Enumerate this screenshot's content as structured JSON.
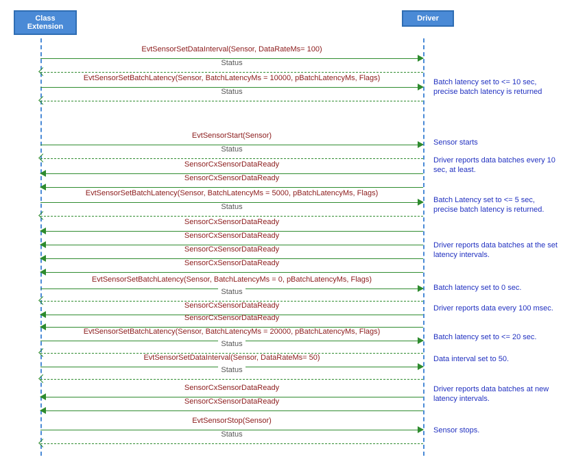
{
  "actors": {
    "left": "Class Extension",
    "right": "Driver"
  },
  "messages": {
    "m01": "EvtSensorSetDataInterval(Sensor, DataRateMs= 100)",
    "s01": "Status",
    "m02": "EvtSensorSetBatchLatency(Sensor, BatchLatencyMs = 10000, pBatchLatencyMs, Flags)",
    "s02": "Status",
    "m03": "EvtSensorStart(Sensor)",
    "s03": "Status",
    "m04": "SensorCxSensorDataReady",
    "m05": "SensorCxSensorDataReady",
    "m06": "EvtSensorSetBatchLatency(Sensor, BatchLatencyMs =  5000, pBatchLatencyMs, Flags)",
    "s06": "Status",
    "m07": "SensorCxSensorDataReady",
    "m08": "SensorCxSensorDataReady",
    "m09": "SensorCxSensorDataReady",
    "m10": "SensorCxSensorDataReady",
    "m11": "EvtSensorSetBatchLatency(Sensor, BatchLatencyMs = 0,  pBatchLatencyMs, Flags)",
    "s11": "Status",
    "m12": "SensorCxSensorDataReady",
    "m13": "SensorCxSensorDataReady",
    "m14": "EvtSensorSetBatchLatency(Sensor, BatchLatencyMs = 20000, pBatchLatencyMs, Flags)",
    "s14": "Status",
    "m15": "EvtSensorSetDataInterval(Sensor, DataRateMs= 50)",
    "s15": "Status",
    "m16": "SensorCxSensorDataReady",
    "m17": "SensorCxSensorDataReady",
    "m18": "EvtSensorStop(Sensor)",
    "s18": "Status"
  },
  "notes": {
    "a": "Batch latency set to <= 10 sec, precise batch latency is returned",
    "b": "Sensor starts",
    "c": "Driver reports data batches every 10 sec, at least.",
    "d": "Batch Latency set to <= 5 sec, precise batch latency is returned.",
    "e": "Driver reports data batches at the set latency intervals.",
    "f": "Batch latency set to 0 sec.",
    "g": "Driver reports data every 100 msec.",
    "h": "Batch latency set to <= 20 sec.",
    "i": "Data interval set to 50.",
    "j": "Driver reports data batches at new latency intervals.",
    "k": "Sensor stops."
  }
}
